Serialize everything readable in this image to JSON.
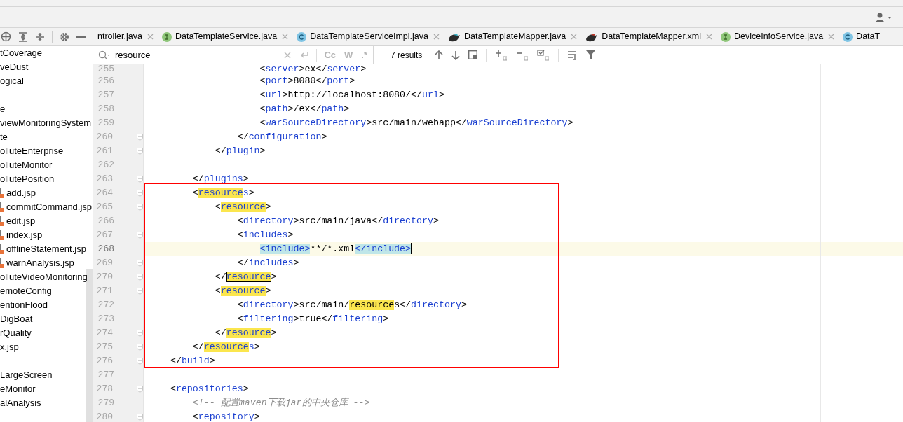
{
  "project_tree": {
    "items": [
      {
        "kind": "folder",
        "label": "tCoverage"
      },
      {
        "kind": "folder",
        "label": "veDust"
      },
      {
        "kind": "folder",
        "label": "ogical"
      },
      {
        "kind": "spacer"
      },
      {
        "kind": "folder",
        "label": "e"
      },
      {
        "kind": "folder",
        "label": "viewMonitoringSystem"
      },
      {
        "kind": "folder",
        "label": "te"
      },
      {
        "kind": "folder",
        "label": "olluteEnterprise"
      },
      {
        "kind": "folder",
        "label": "olluteMonitor"
      },
      {
        "kind": "folder",
        "label": "ollutePosition"
      },
      {
        "kind": "jsp",
        "label": "add.jsp"
      },
      {
        "kind": "jsp",
        "label": "commitCommand.jsp"
      },
      {
        "kind": "jsp",
        "label": "edit.jsp"
      },
      {
        "kind": "jsp",
        "label": "index.jsp"
      },
      {
        "kind": "jsp",
        "label": "offlineStatement.jsp"
      },
      {
        "kind": "jsp",
        "label": "warnAnalysis.jsp"
      },
      {
        "kind": "folder",
        "label": "olluteVideoMonitoring"
      },
      {
        "kind": "folder",
        "label": "emoteConfig"
      },
      {
        "kind": "folder",
        "label": "entionFlood"
      },
      {
        "kind": "folder",
        "label": "DigBoat"
      },
      {
        "kind": "folder",
        "label": "rQuality"
      },
      {
        "kind": "folder",
        "label": "x.jsp"
      },
      {
        "kind": "spacer"
      },
      {
        "kind": "folder",
        "label": "LargeScreen"
      },
      {
        "kind": "folder",
        "label": "eMonitor"
      },
      {
        "kind": "folder",
        "label": "alAnalysis"
      }
    ]
  },
  "tabs": [
    {
      "kind": "plain",
      "label": "ntroller.java",
      "closable": true
    },
    {
      "kind": "interface",
      "label": "DataTemplateService.java",
      "closable": true
    },
    {
      "kind": "class",
      "label": "DataTemplateServiceImpl.java",
      "closable": true
    },
    {
      "kind": "mapper",
      "label": "DataTemplateMapper.java",
      "closable": true
    },
    {
      "kind": "mapper-xml",
      "label": "DataTemplateMapper.xml",
      "closable": true
    },
    {
      "kind": "interface",
      "label": "DeviceInfoService.java",
      "closable": true
    },
    {
      "kind": "class",
      "label": "DataT",
      "closable": false
    }
  ],
  "search": {
    "value": "resource",
    "options": [
      "Cc",
      "W",
      ".*"
    ],
    "results": "7 results"
  },
  "editor": {
    "lines": [
      {
        "number": "255",
        "segments": [
          {
            "text": "                    <",
            "kind": "punct"
          },
          {
            "text": "server",
            "kind": "tag"
          },
          {
            "text": ">ex</",
            "kind": "punct"
          },
          {
            "text": "server",
            "kind": "tag"
          },
          {
            "text": ">",
            "kind": "punct"
          }
        ]
      },
      {
        "number": "256",
        "segments": [
          {
            "text": "                    <",
            "kind": "punct"
          },
          {
            "text": "port",
            "kind": "tag"
          },
          {
            "text": ">8080</",
            "kind": "punct"
          },
          {
            "text": "port",
            "kind": "tag"
          },
          {
            "text": ">",
            "kind": "punct"
          }
        ]
      },
      {
        "number": "257",
        "segments": [
          {
            "text": "                    <",
            "kind": "punct"
          },
          {
            "text": "url",
            "kind": "tag"
          },
          {
            "text": ">http://localhost:8080/</",
            "kind": "punct"
          },
          {
            "text": "url",
            "kind": "tag"
          },
          {
            "text": ">",
            "kind": "punct"
          }
        ]
      },
      {
        "number": "258",
        "segments": [
          {
            "text": "                    <",
            "kind": "punct"
          },
          {
            "text": "path",
            "kind": "tag"
          },
          {
            "text": ">/ex</",
            "kind": "punct"
          },
          {
            "text": "path",
            "kind": "tag"
          },
          {
            "text": ">",
            "kind": "punct"
          }
        ]
      },
      {
        "number": "259",
        "segments": [
          {
            "text": "                    <",
            "kind": "punct"
          },
          {
            "text": "warSourceDirectory",
            "kind": "tag"
          },
          {
            "text": ">src/main/webapp</",
            "kind": "punct"
          },
          {
            "text": "warSourceDirectory",
            "kind": "tag"
          },
          {
            "text": ">",
            "kind": "punct"
          }
        ]
      },
      {
        "number": "260",
        "fold": true,
        "segments": [
          {
            "text": "                </",
            "kind": "punct"
          },
          {
            "text": "configuration",
            "kind": "tag"
          },
          {
            "text": ">",
            "kind": "punct"
          }
        ]
      },
      {
        "number": "261",
        "fold": true,
        "segments": [
          {
            "text": "            </",
            "kind": "punct"
          },
          {
            "text": "plugin",
            "kind": "tag"
          },
          {
            "text": ">",
            "kind": "punct"
          }
        ]
      },
      {
        "number": "262",
        "fold": false
      },
      {
        "number": "263",
        "fold": true,
        "segments": [
          {
            "text": "        </",
            "kind": "punct"
          },
          {
            "text": "plugins",
            "kind": "tag"
          },
          {
            "text": ">",
            "kind": "punct"
          }
        ]
      },
      {
        "number": "264",
        "fold": true,
        "segments": [
          {
            "text": "        <",
            "kind": "punct"
          },
          {
            "text": "resource",
            "kind": "tag",
            "match": true
          },
          {
            "text": "s",
            "kind": "tag"
          },
          {
            "text": ">",
            "kind": "punct"
          }
        ]
      },
      {
        "number": "265",
        "fold": true,
        "segments": [
          {
            "text": "            <",
            "kind": "punct"
          },
          {
            "text": "resource",
            "kind": "tag",
            "match": true
          },
          {
            "text": ">",
            "kind": "punct"
          }
        ]
      },
      {
        "number": "266",
        "fold": false,
        "segments": [
          {
            "text": "                <",
            "kind": "punct"
          },
          {
            "text": "directory",
            "kind": "tag"
          },
          {
            "text": ">src/main/java</",
            "kind": "punct"
          },
          {
            "text": "directory",
            "kind": "tag"
          },
          {
            "text": ">",
            "kind": "punct"
          }
        ]
      },
      {
        "number": "267",
        "fold": true,
        "segments": [
          {
            "text": "                <",
            "kind": "punct"
          },
          {
            "text": "includes",
            "kind": "tag"
          },
          {
            "text": ">",
            "kind": "punct"
          }
        ]
      },
      {
        "number": "268",
        "current": true,
        "segments": [
          {
            "text": "                    <include>",
            "kind": "tag",
            "brace_match": true
          },
          {
            "text": "**/*.xml",
            "kind": "punct"
          },
          {
            "text": "</include>",
            "kind": "tag",
            "brace_match": true
          }
        ]
      },
      {
        "number": "269",
        "fold": true,
        "segments": [
          {
            "text": "                </",
            "kind": "punct"
          },
          {
            "text": "includes",
            "kind": "tag"
          },
          {
            "text": ">",
            "kind": "punct"
          }
        ]
      },
      {
        "number": "270",
        "fold": true,
        "segments": [
          {
            "text": "            </",
            "kind": "punct"
          },
          {
            "text": "resource",
            "kind": "tag",
            "match": true,
            "selected": true
          },
          {
            "text": ">",
            "kind": "punct"
          }
        ]
      },
      {
        "number": "271",
        "fold": true,
        "segments": [
          {
            "text": "            <",
            "kind": "punct"
          },
          {
            "text": "resource",
            "kind": "tag",
            "match": true
          },
          {
            "text": ">",
            "kind": "punct"
          }
        ]
      },
      {
        "number": "272",
        "fold": false,
        "segments": [
          {
            "text": "                <",
            "kind": "punct"
          },
          {
            "text": "directory",
            "kind": "tag"
          },
          {
            "text": ">src/main/",
            "kind": "punct"
          },
          {
            "text": "resource",
            "kind": "punct",
            "match": true
          },
          {
            "text": "s</",
            "kind": "punct"
          },
          {
            "text": "directory",
            "kind": "tag"
          },
          {
            "text": ">",
            "kind": "punct"
          }
        ]
      },
      {
        "number": "273",
        "fold": false,
        "segments": [
          {
            "text": "                <",
            "kind": "punct"
          },
          {
            "text": "filtering",
            "kind": "tag"
          },
          {
            "text": ">true</",
            "kind": "punct"
          },
          {
            "text": "filtering",
            "kind": "tag"
          },
          {
            "text": ">",
            "kind": "punct"
          }
        ]
      },
      {
        "number": "274",
        "fold": true,
        "segments": [
          {
            "text": "            </",
            "kind": "punct"
          },
          {
            "text": "resource",
            "kind": "tag",
            "match": true
          },
          {
            "text": ">",
            "kind": "punct"
          }
        ]
      },
      {
        "number": "275",
        "fold": true,
        "segments": [
          {
            "text": "        </",
            "kind": "punct"
          },
          {
            "text": "resource",
            "kind": "tag",
            "match": true
          },
          {
            "text": "s",
            "kind": "tag"
          },
          {
            "text": ">",
            "kind": "punct"
          }
        ]
      },
      {
        "number": "276",
        "fold": true,
        "segments": [
          {
            "text": "    </",
            "kind": "punct"
          },
          {
            "text": "build",
            "kind": "tag"
          },
          {
            "text": ">",
            "kind": "punct"
          }
        ]
      },
      {
        "number": "277",
        "fold": false
      },
      {
        "number": "278",
        "fold": true,
        "segments": [
          {
            "text": "    <",
            "kind": "punct"
          },
          {
            "text": "repositories",
            "kind": "tag"
          },
          {
            "text": ">",
            "kind": "punct"
          }
        ]
      },
      {
        "number": "279",
        "fold": false,
        "segments": [
          {
            "text": "        <!-- 配置maven下载jar的中央仓库 -->",
            "kind": "comment"
          }
        ]
      },
      {
        "number": "280",
        "fold": true,
        "segments": [
          {
            "text": "        <",
            "kind": "punct"
          },
          {
            "text": "repository",
            "kind": "tag"
          },
          {
            "text": ">",
            "kind": "punct"
          }
        ]
      }
    ]
  }
}
